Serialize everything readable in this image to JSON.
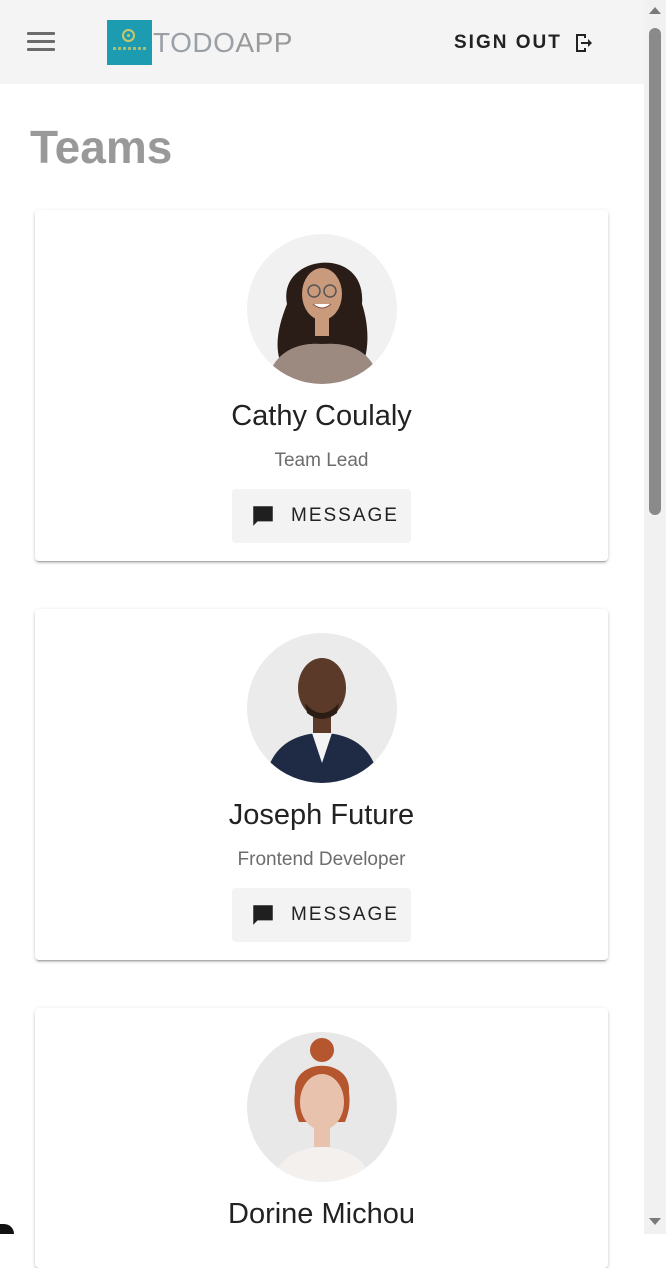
{
  "header": {
    "brand_todo": "TODO",
    "brand_app": "APP",
    "sign_out_label": "SIGN OUT"
  },
  "page": {
    "title": "Teams"
  },
  "members": [
    {
      "name": "Cathy Coulaly",
      "role": "Team Lead",
      "message_label": "MESSAGE"
    },
    {
      "name": "Joseph Future",
      "role": "Frontend Developer",
      "message_label": "MESSAGE"
    },
    {
      "name": "Dorine Michou",
      "role": "",
      "message_label": ""
    }
  ],
  "colors": {
    "appbar_bg": "#f4f4f4",
    "logo_bg": "#1d9bb1",
    "title_gray": "#999999",
    "button_bg": "#f3f3f3"
  },
  "icons": {
    "menu": "hamburger-menu-icon",
    "sign_out": "logout-icon",
    "message": "chat-bubble-icon"
  }
}
